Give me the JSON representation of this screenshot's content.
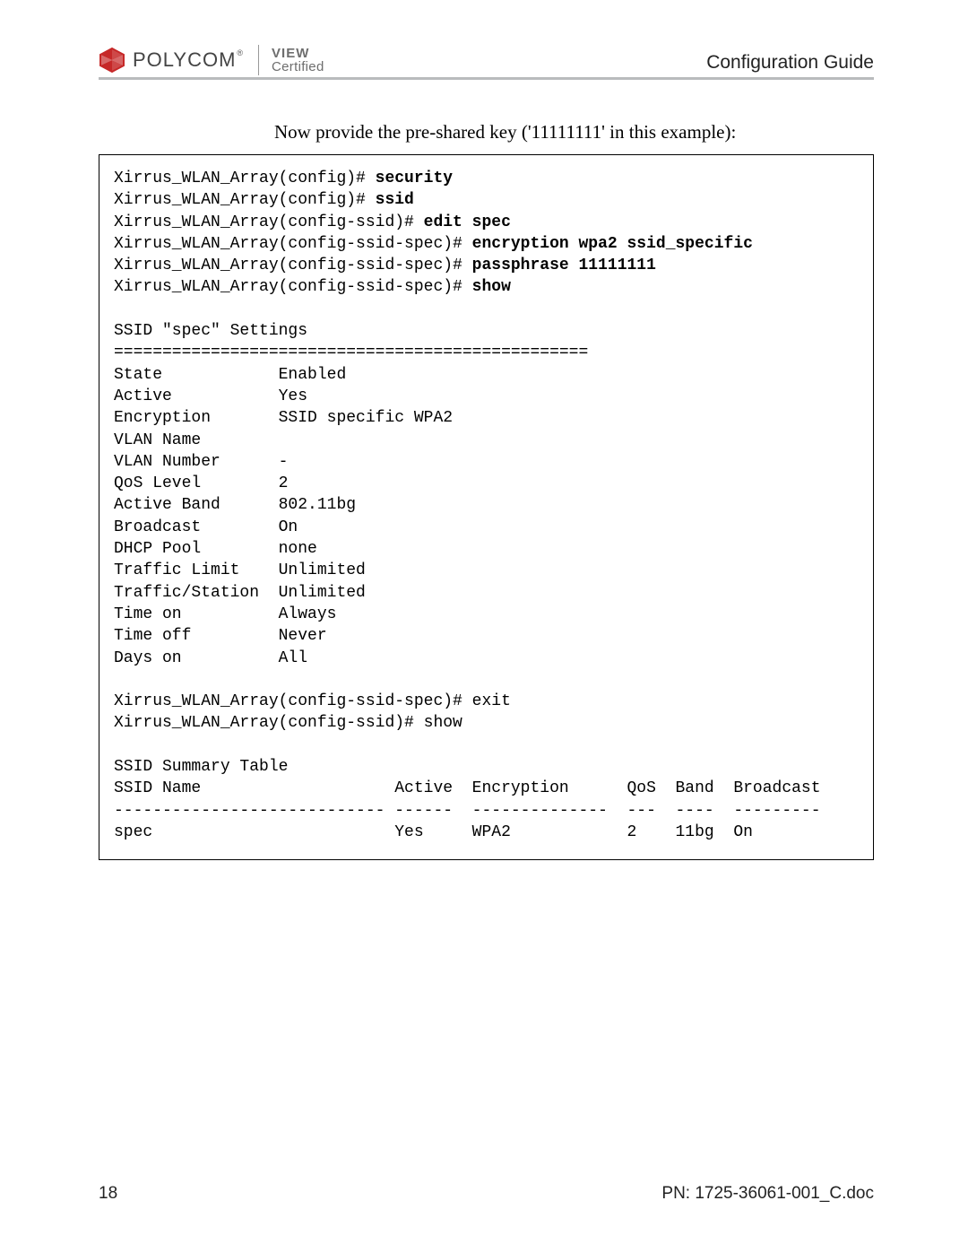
{
  "header": {
    "brand": "POLYCOM",
    "reg": "®",
    "cert_top": "VIEW",
    "cert_bot": "Certified",
    "guide": "Configuration Guide"
  },
  "intro": "Now provide the pre-shared key ('11111111' in this example):",
  "cli": {
    "l1_prompt": "Xirrus_WLAN_Array(config)# ",
    "l1_cmd": "security",
    "l2_prompt": "Xirrus_WLAN_Array(config)# ",
    "l2_cmd": "ssid",
    "l3_prompt": "Xirrus_WLAN_Array(config-ssid)# ",
    "l3_cmd": "edit spec",
    "l4_prompt": "Xirrus_WLAN_Array(config-ssid-spec)# ",
    "l4_cmd": "encryption wpa2 ssid_specific",
    "l5_prompt": "Xirrus_WLAN_Array(config-ssid-spec)# ",
    "l5_cmd": "passphrase 11111111",
    "l6_prompt": "Xirrus_WLAN_Array(config-ssid-spec)# ",
    "l6_cmd": "show",
    "blank1": "",
    "settings_title": "SSID \"spec\" Settings",
    "settings_sep": "=================================================",
    "s_state": "State            Enabled",
    "s_active": "Active           Yes",
    "s_enc": "Encryption       SSID specific WPA2",
    "s_vlan_name": "VLAN Name",
    "s_vlan_num": "VLAN Number      -",
    "s_qos": "QoS Level        2",
    "s_band": "Active Band      802.11bg",
    "s_bcast": "Broadcast        On",
    "s_dhcp": "DHCP Pool        none",
    "s_tlimit": "Traffic Limit    Unlimited",
    "s_tstation": "Traffic/Station  Unlimited",
    "s_ton": "Time on          Always",
    "s_toff": "Time off         Never",
    "s_days": "Days on          All",
    "blank2": "",
    "exit_line": "Xirrus_WLAN_Array(config-ssid-spec)# exit",
    "show_line": "Xirrus_WLAN_Array(config-ssid)# show",
    "blank3": "",
    "sum_title": "SSID Summary Table",
    "sum_header": "SSID Name                    Active  Encryption      QoS  Band  Broadcast",
    "sum_sep": "---------------------------- ------  --------------  ---  ----  ---------",
    "sum_row": "spec                         Yes     WPA2            2    11bg  On"
  },
  "footer": {
    "page": "18",
    "pn": "PN: 1725-36061-001_C.doc"
  }
}
